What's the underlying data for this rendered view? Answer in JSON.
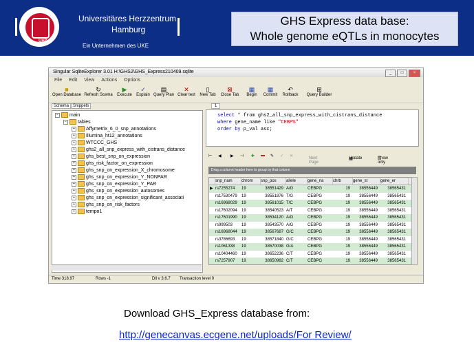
{
  "header": {
    "org_line1": "Universitäres Herzzentrum",
    "org_line2": "Hamburg",
    "org_line3": "Ein Unternehmen des UKE",
    "seal_text": "UHZ",
    "title_line1": "GHS Express data base:",
    "title_line2": "Whole genome eQTLs in monocytes",
    "band_color": "#0c2e86"
  },
  "window": {
    "title": "Singular SqliteExplorer 3.01 H:\\GHS2\\GHS_Express210409.sqlite",
    "menu": [
      "File",
      "Edit",
      "View",
      "Actions",
      "Options"
    ],
    "toolbar": [
      "Open Database",
      "Refresh Scema",
      "Execute",
      "Explain",
      "Query Plan",
      "Clear text",
      "New Tab",
      "Close Tab",
      "Begin",
      "Commit",
      "Rollback",
      "Query Builder"
    ],
    "schema_tabs": [
      "Schema",
      "Snippets"
    ],
    "tree": {
      "root": "main",
      "tables_label": "tables",
      "items": [
        "Affymetrix_6_0_snp_annotations",
        "Illumina_ht12_annotations",
        "WTCCC_GHS",
        "ghs2_all_snp_express_with_cistrans_distance",
        "ghs_best_snp_on_expression",
        "ghs_risk_factor_on_expression",
        "ghs_snp_on_expression_X_chromosome",
        "ghs_snp_on_expression_Y_NONPAR",
        "ghs_snp_on_expression_Y_PAR",
        "ghs_snp_on_expression_autosomes",
        "ghs_snp_on_expression_significant_associati",
        "ghs_snp_on_risk_factors",
        "tempo1"
      ]
    },
    "editor_tab": "1",
    "sql": {
      "select_kw": "select",
      "select_rest": " * from ghs2_all_snp_express_with_cistrans_distance",
      "where_kw": "where",
      "where_rest": " gene_name like ",
      "where_str": "\"CEBP%\"",
      "order_kw": "order by",
      "order_rest": " p_val asc;"
    },
    "grid_toolbar": {
      "next_page": "Next Page",
      "update": "Update",
      "show_only": "Show only"
    },
    "group_bar": "Drag a column header here to group by that column",
    "columns": [
      "snp_nam",
      "chrom",
      "snp_pos",
      "allele",
      "gene_na",
      "chrb",
      "gene_st",
      "gene_er"
    ],
    "rows": [
      [
        "rs7255274",
        "19",
        "38551429",
        "A/G",
        "CEBPG",
        "19",
        "38556449",
        "38565431"
      ],
      [
        "rs17530479",
        "19",
        "38551876",
        "T/G",
        "CEBPG",
        "19",
        "38556449",
        "38565431"
      ],
      [
        "rs16968029",
        "19",
        "38561015",
        "T/C",
        "CEBPG",
        "19",
        "38556449",
        "38565431"
      ],
      [
        "rs17602094",
        "19",
        "38540523",
        "A/T",
        "CEBPG",
        "19",
        "38556449",
        "38565431"
      ],
      [
        "rs17601990",
        "19",
        "38534120",
        "A/G",
        "CEBPG",
        "19",
        "38556449",
        "38565431"
      ],
      [
        "rs999503",
        "19",
        "38543570",
        "A/G",
        "CEBPG",
        "19",
        "38556449",
        "38565431"
      ],
      [
        "rs16968044",
        "19",
        "38567687",
        "G/C",
        "CEBPG",
        "19",
        "38556449",
        "38565431"
      ],
      [
        "rs3786693",
        "19",
        "38571840",
        "G/C",
        "CEBPG",
        "19",
        "38556449",
        "38565431"
      ],
      [
        "rs1061338",
        "19",
        "38570038",
        "G/A",
        "CEBPG",
        "19",
        "38556449",
        "38565431"
      ],
      [
        "rs10404460",
        "19",
        "38652236",
        "C/T",
        "CEBPG",
        "19",
        "38556449",
        "38565431"
      ],
      [
        "rs7257907",
        "19",
        "38650982",
        "C/T",
        "CEBPG",
        "19",
        "38556449",
        "38565431"
      ]
    ],
    "status": {
      "time": "Time 318.97",
      "rows": "Rows -1",
      "dll": "Dll v 3.6.7",
      "transaction": "Transaction level 0"
    }
  },
  "caption": "Download GHS_Express database from:",
  "link": "http://genecanvas.ecgene.net/uploads/For Review/"
}
